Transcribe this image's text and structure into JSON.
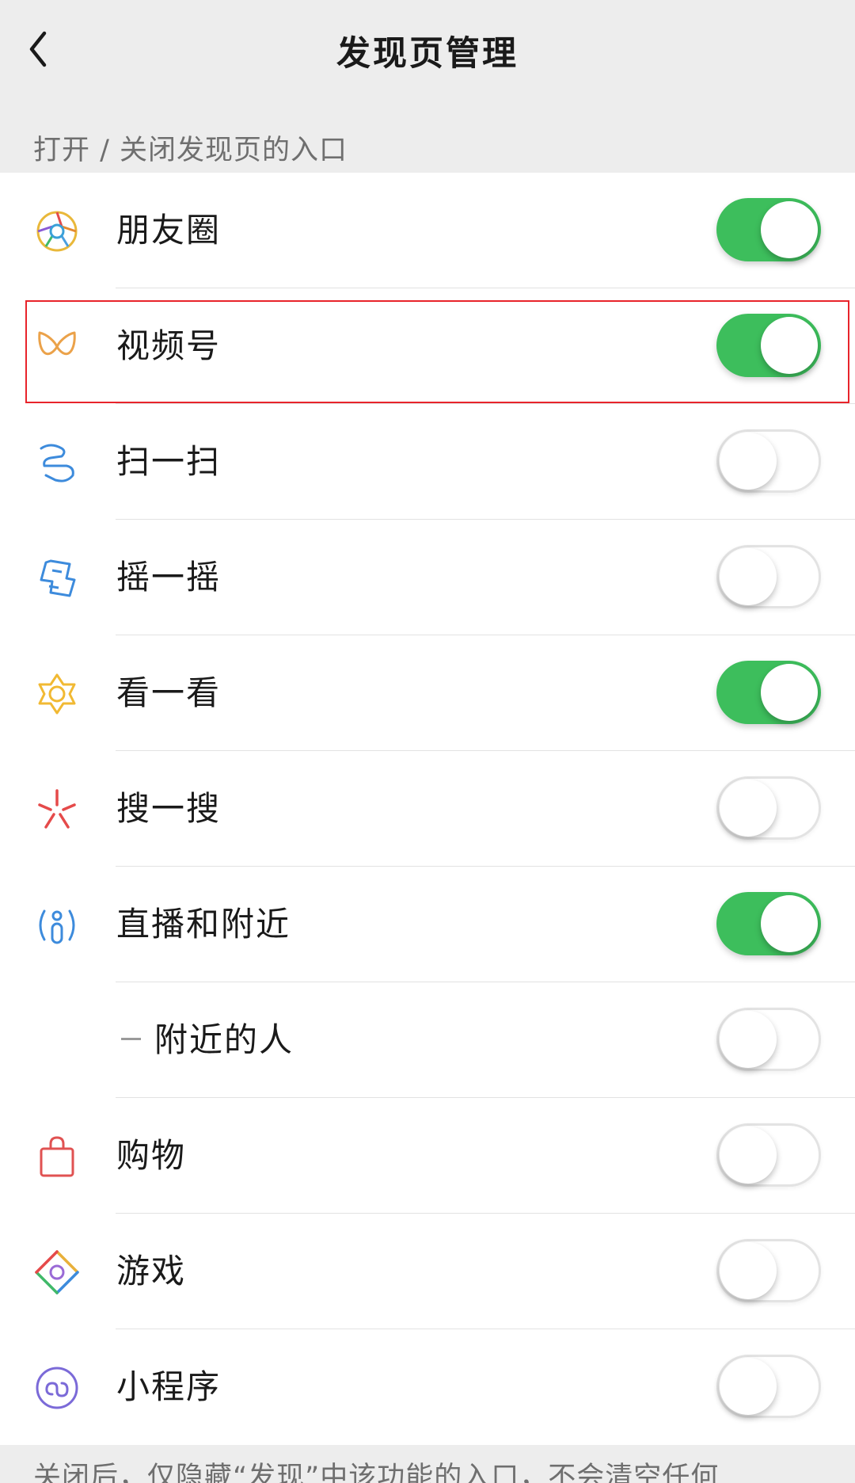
{
  "header": {
    "title": "发现页管理",
    "back_icon": "chevron-left-icon"
  },
  "section": {
    "header": "打开 / 关闭发现页的入口"
  },
  "items": [
    {
      "label": "朋友圈",
      "icon": "moments-icon",
      "on": true
    },
    {
      "label": "视频号",
      "icon": "channels-icon",
      "on": true,
      "highlighted": true
    },
    {
      "label": "扫一扫",
      "icon": "scan-icon",
      "on": false
    },
    {
      "label": "摇一摇",
      "icon": "shake-icon",
      "on": false
    },
    {
      "label": "看一看",
      "icon": "top-stories-icon",
      "on": true
    },
    {
      "label": "搜一搜",
      "icon": "search-icon",
      "on": false
    },
    {
      "label": "直播和附近",
      "icon": "live-nearby-icon",
      "on": true
    },
    {
      "label": "附近的人",
      "icon": "",
      "on": false,
      "sub": true
    },
    {
      "label": "购物",
      "icon": "shopping-bag-icon",
      "on": false
    },
    {
      "label": "游戏",
      "icon": "games-icon",
      "on": false
    },
    {
      "label": "小程序",
      "icon": "mini-program-icon",
      "on": false
    }
  ],
  "footer": {
    "note": "关闭后，仅隐藏“发现”中该功能的入口，不会清空任何"
  },
  "colors": {
    "toggle_on": "#3dbe5c",
    "highlight_border": "#e8242b",
    "background": "#ededed"
  }
}
